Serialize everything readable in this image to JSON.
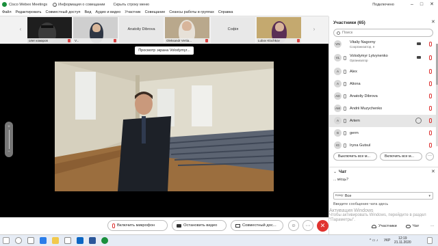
{
  "titlebar": {
    "app_title": "Cisco Webex Meetings",
    "meeting_info": "Информация о совещании",
    "hide_menu": "Скрыть строку меню",
    "connected": "Подключено",
    "minimize": "–",
    "maximize": "□",
    "close": "✕"
  },
  "menu": [
    "Файл",
    "Редактировать",
    "Совместный доступ",
    "Вид",
    "Аудио и видео",
    "Участник",
    "Совещание",
    "Сеансы работы в группах",
    "Справка"
  ],
  "strip": {
    "prev": "‹",
    "next": "›",
    "thumbs": [
      {
        "name": "олег комаров"
      },
      {
        "name": "V..."
      },
      {
        "name": "Anatoliy Dibrova"
      },
      {
        "name": "Oleksandr Vertia..."
      },
      {
        "name": "Софія"
      },
      {
        "name": "Lubov Klochkov"
      }
    ]
  },
  "share_banner": "Просмотр экрана Volodymyr...",
  "zoom": {
    "plus": "+",
    "minus": "−"
  },
  "controls": {
    "mic_label": "Включить микрофон",
    "video_label": "Остановить видео",
    "share_label": "Совместный дос...",
    "reactions": "☺",
    "more": "···",
    "end": "✕",
    "participants_tab": "Участники",
    "chat_tab": "Чат"
  },
  "panel": {
    "title": "Участники (65)",
    "close": "✕",
    "search_placeholder": "Поиск",
    "participants": [
      {
        "initials": "VN",
        "name": "Vitaliy Nagorny",
        "role": "Соорганизатор, я"
      },
      {
        "initials": "VL",
        "name": "Volodymyr Lytvynenko",
        "role": "Организатор"
      },
      {
        "initials": "A",
        "name": "Alex",
        "role": ""
      },
      {
        "initials": "A",
        "name": "Aliona",
        "role": ""
      },
      {
        "initials": "AD",
        "name": "Anatoliy Dibrova",
        "role": ""
      },
      {
        "initials": "AM",
        "name": "Andrii Muzychenko",
        "role": ""
      },
      {
        "initials": "A",
        "name": "Artem",
        "role": ""
      },
      {
        "initials": "G",
        "name": "germ",
        "role": ""
      },
      {
        "initials": "IG",
        "name": "Iryna Gutsul",
        "role": ""
      }
    ],
    "mute_all": "Выключить все м...",
    "unmute_all": "Включить все м...",
    "more": "···"
  },
  "chat": {
    "title": "Чат",
    "chevron": "⌄",
    "close": "✕",
    "message": "... місць?",
    "to_label": "Кому:",
    "to_value": "Все",
    "input_placeholder": "Введите сообщение чата здесь",
    "watermark_line1": "Активация Windows",
    "watermark_line2": "Чтобы активировать Windows, перейдите в раздел",
    "watermark_line3": "\"Параметры\"."
  },
  "taskbar": {
    "lang": "УКР",
    "time": "12:19",
    "date": "21.11.2020"
  },
  "colors": {
    "accent_red": "#e0332f",
    "end_call": "#e0332f",
    "panel_bg": "#ffffff"
  }
}
